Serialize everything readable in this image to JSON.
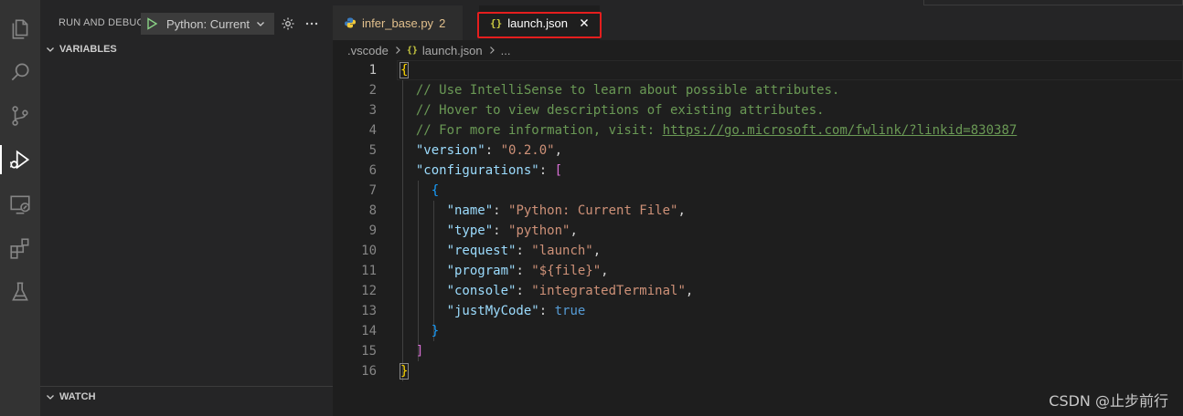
{
  "activity_bar": {
    "icons": [
      "explorer-icon",
      "search-icon",
      "source-control-icon",
      "run-debug-icon",
      "remote-explorer-icon",
      "extensions-icon",
      "testing-icon"
    ]
  },
  "sidebar": {
    "title": "RUN AND DEBUG",
    "launch_config": "Python: Current",
    "sections": [
      {
        "label": "VARIABLES",
        "expanded": true
      },
      {
        "label": "WATCH",
        "expanded": true
      }
    ]
  },
  "tabs": [
    {
      "label": "infer_base.py",
      "problems": "2",
      "active": false,
      "icon": "python-icon"
    },
    {
      "label": "launch.json",
      "active": true,
      "icon": "json-icon",
      "icon_text": "{}"
    }
  ],
  "breadcrumb": [
    ".vscode",
    "launch.json",
    "..."
  ],
  "editor": {
    "current_line": 1,
    "lines": [
      {
        "n": "1",
        "tokens": [
          {
            "t": "{",
            "c": "b1 bracket-match"
          }
        ]
      },
      {
        "n": "2",
        "tokens": [
          {
            "t": "  // Use IntelliSense to learn about possible attributes.",
            "c": "c"
          }
        ]
      },
      {
        "n": "3",
        "tokens": [
          {
            "t": "  // Hover to view descriptions of existing attributes.",
            "c": "c"
          }
        ]
      },
      {
        "n": "4",
        "tokens": [
          {
            "t": "  // For more information, visit: ",
            "c": "c"
          },
          {
            "t": "https://go.microsoft.com/fwlink/?linkid=830387",
            "c": "c url"
          }
        ]
      },
      {
        "n": "5",
        "tokens": [
          {
            "t": "  ",
            "c": "p"
          },
          {
            "t": "\"version\"",
            "c": "k"
          },
          {
            "t": ": ",
            "c": "p"
          },
          {
            "t": "\"0.2.0\"",
            "c": "s"
          },
          {
            "t": ",",
            "c": "p"
          }
        ]
      },
      {
        "n": "6",
        "tokens": [
          {
            "t": "  ",
            "c": "p"
          },
          {
            "t": "\"configurations\"",
            "c": "k"
          },
          {
            "t": ": ",
            "c": "p"
          },
          {
            "t": "[",
            "c": "b2"
          }
        ]
      },
      {
        "n": "7",
        "tokens": [
          {
            "t": "    ",
            "c": "p"
          },
          {
            "t": "{",
            "c": "b3"
          }
        ]
      },
      {
        "n": "8",
        "tokens": [
          {
            "t": "      ",
            "c": "p"
          },
          {
            "t": "\"name\"",
            "c": "k"
          },
          {
            "t": ": ",
            "c": "p"
          },
          {
            "t": "\"Python: Current File\"",
            "c": "s"
          },
          {
            "t": ",",
            "c": "p"
          }
        ]
      },
      {
        "n": "9",
        "tokens": [
          {
            "t": "      ",
            "c": "p"
          },
          {
            "t": "\"type\"",
            "c": "k"
          },
          {
            "t": ": ",
            "c": "p"
          },
          {
            "t": "\"python\"",
            "c": "s"
          },
          {
            "t": ",",
            "c": "p"
          }
        ]
      },
      {
        "n": "10",
        "tokens": [
          {
            "t": "      ",
            "c": "p"
          },
          {
            "t": "\"request\"",
            "c": "k"
          },
          {
            "t": ": ",
            "c": "p"
          },
          {
            "t": "\"launch\"",
            "c": "s"
          },
          {
            "t": ",",
            "c": "p"
          }
        ]
      },
      {
        "n": "11",
        "tokens": [
          {
            "t": "      ",
            "c": "p"
          },
          {
            "t": "\"program\"",
            "c": "k"
          },
          {
            "t": ": ",
            "c": "p"
          },
          {
            "t": "\"${file}\"",
            "c": "s"
          },
          {
            "t": ",",
            "c": "p"
          }
        ]
      },
      {
        "n": "12",
        "tokens": [
          {
            "t": "      ",
            "c": "p"
          },
          {
            "t": "\"console\"",
            "c": "k"
          },
          {
            "t": ": ",
            "c": "p"
          },
          {
            "t": "\"integratedTerminal\"",
            "c": "s"
          },
          {
            "t": ",",
            "c": "p"
          }
        ]
      },
      {
        "n": "13",
        "tokens": [
          {
            "t": "      ",
            "c": "p"
          },
          {
            "t": "\"justMyCode\"",
            "c": "k"
          },
          {
            "t": ": ",
            "c": "p"
          },
          {
            "t": "true",
            "c": "kw"
          }
        ]
      },
      {
        "n": "14",
        "tokens": [
          {
            "t": "    ",
            "c": "p"
          },
          {
            "t": "}",
            "c": "b3"
          }
        ]
      },
      {
        "n": "15",
        "tokens": [
          {
            "t": "  ",
            "c": "p"
          },
          {
            "t": "]",
            "c": "b2"
          }
        ]
      },
      {
        "n": "16",
        "tokens": [
          {
            "t": "}",
            "c": "b1 bracket-match"
          }
        ]
      }
    ]
  },
  "watermark": "CSDN @止步前行",
  "colors": {
    "accent": "#007acc",
    "highlight_box": "#e51e1e",
    "json_icon": "#cbcb41",
    "modified_tab": "#e2c08d"
  }
}
